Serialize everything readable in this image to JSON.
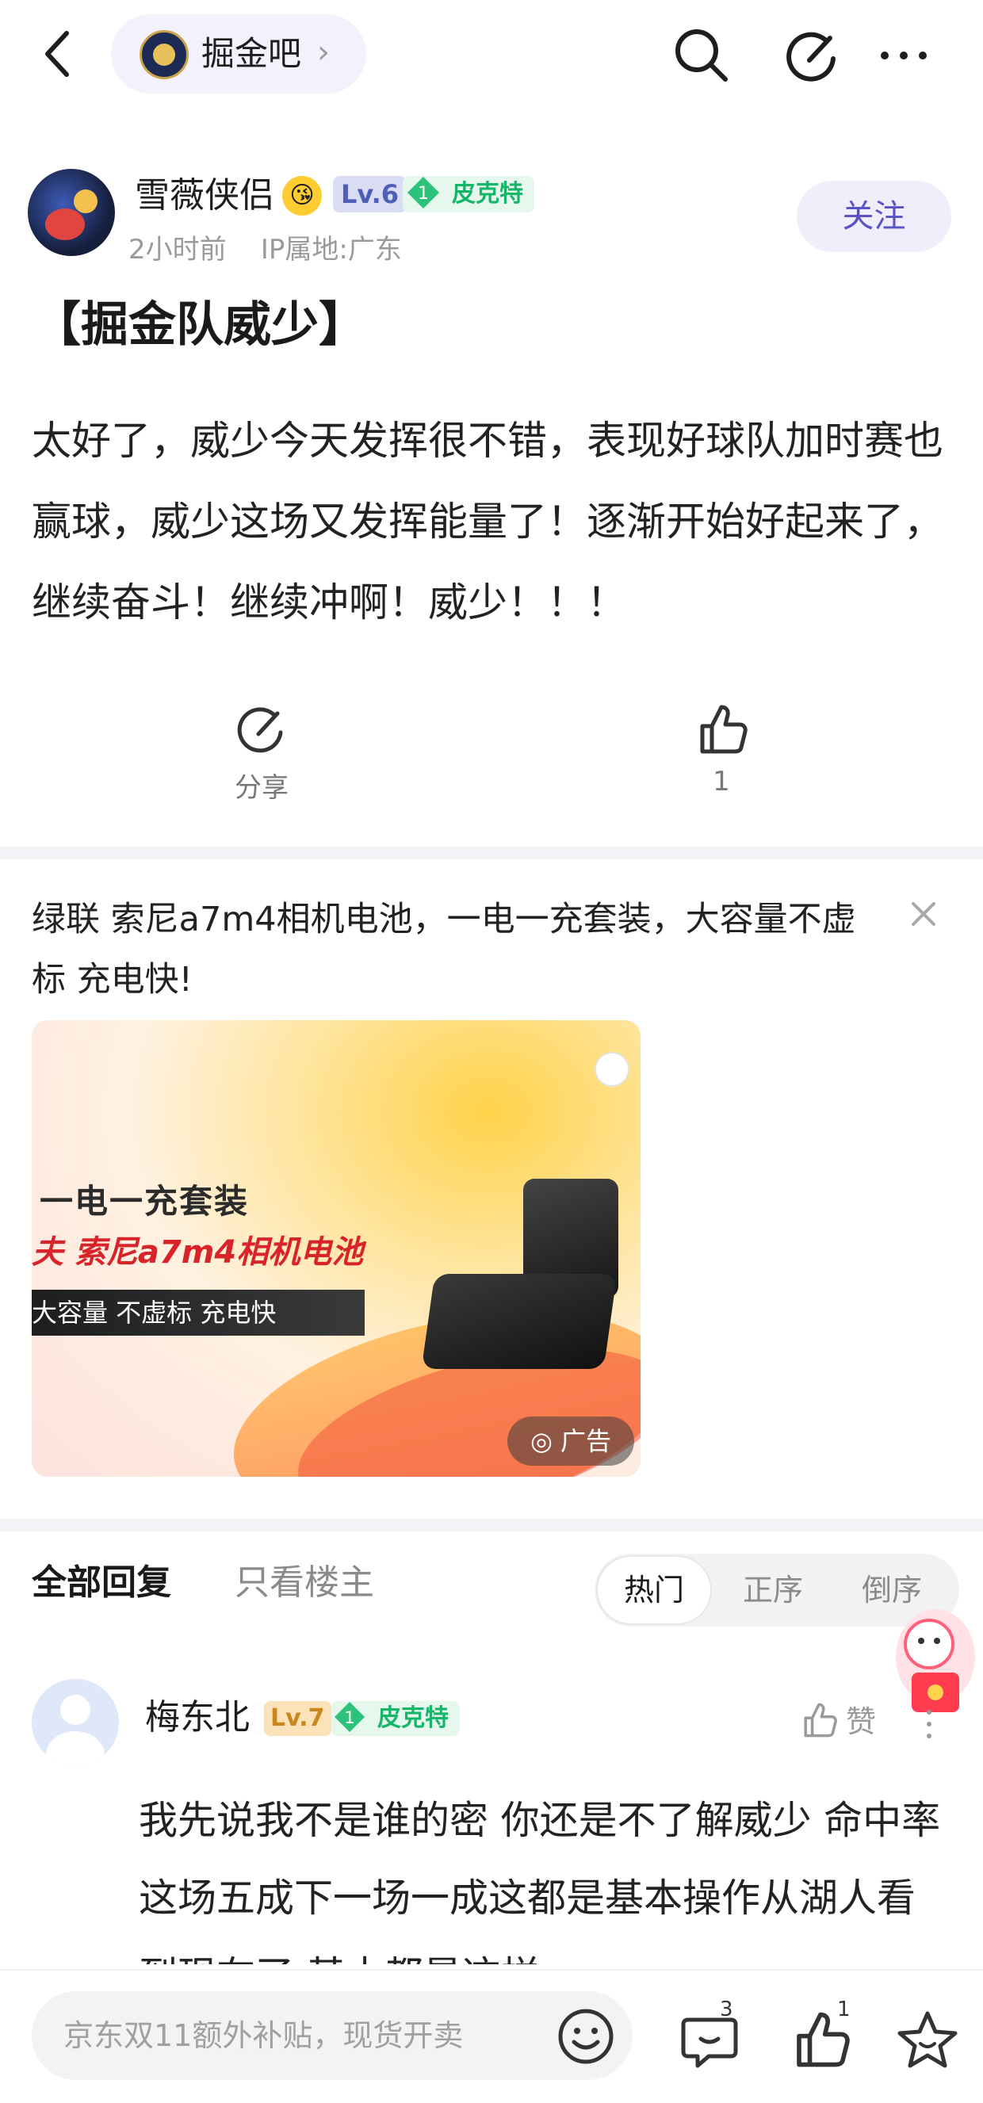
{
  "topbar": {
    "forum_name": "掘金吧",
    "chevron": "›"
  },
  "post": {
    "author": "雪薇侠侣",
    "level": "Lv.6",
    "tag": "皮克特",
    "tag_level": "1",
    "emoji": "😘",
    "time": "2小时前",
    "ip": "IP属地:广东",
    "follow_label": "关注",
    "title": "【掘金队威少】",
    "body": "太好了，威少今天发挥很不错，表现好球队加时赛也赢球，威少这场又发挥能量了！逐渐开始好起来了，继续奋斗！继续冲啊！威少！！！",
    "share_label": "分享",
    "like_count": "1"
  },
  "ad": {
    "title": "绿联 索尼a7m4相机电池，一电一充套装，大容量不虚标 充电快!",
    "image_line1": "一电一充套装",
    "image_line2": "夫 索尼a7m4相机电池",
    "image_line3": "大容量 不虚标 充电快",
    "image_tag": "广告"
  },
  "replies_header": {
    "tab_all": "全部回复",
    "tab_op": "只看楼主",
    "sort_hot": "热门",
    "sort_asc": "正序",
    "sort_desc": "倒序"
  },
  "reply": {
    "author": "梅东北",
    "level": "Lv.7",
    "tag": "皮克特",
    "tag_level": "1",
    "like_label": "赞",
    "body": "我先说我不是谁的密 你还是不了解威少 命中率这场五成下一场一成这都是基本操作从湖人看到现在了 基本都是这样"
  },
  "bottombar": {
    "input_placeholder": "京东双11额外补贴，现货开卖",
    "comment_count": "3",
    "like_count": "1"
  },
  "colors": {
    "accent": "#5b52c8",
    "tag_green": "#15b66a",
    "divider": "#f2f2f7"
  }
}
